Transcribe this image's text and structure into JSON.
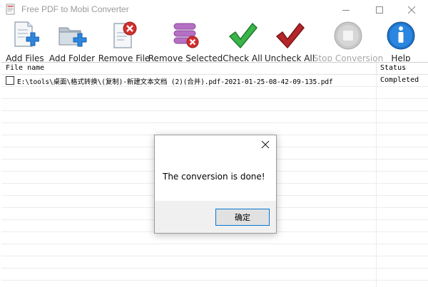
{
  "window": {
    "title": "Free PDF to Mobi Converter"
  },
  "toolbar": {
    "buttons": [
      {
        "label": "Add Files",
        "icon": "add-files-icon"
      },
      {
        "label": "Add Folder",
        "icon": "add-folder-icon"
      },
      {
        "label": "Remove File",
        "icon": "remove-file-icon"
      },
      {
        "label": "Remove Selected",
        "icon": "remove-selected-icon"
      },
      {
        "label": "Check All",
        "icon": "check-all-icon"
      },
      {
        "label": "Uncheck All",
        "icon": "uncheck-all-icon"
      },
      {
        "label": "Stop Conversion",
        "icon": "stop-conversion-icon",
        "disabled": true
      },
      {
        "label": "Help",
        "icon": "help-icon"
      }
    ]
  },
  "list": {
    "headers": {
      "name": "File name",
      "status": "Status"
    },
    "rows": [
      {
        "checked": false,
        "name": "E:\\tools\\桌面\\格式转换\\(复制)-新建文本文档 (2)(合并).pdf-2021-01-25-08-42-09-135.pdf",
        "status": "Completed"
      }
    ]
  },
  "dialog": {
    "message": "The conversion is done!",
    "ok_label": "确定"
  },
  "colors": {
    "accent": "#0078d7",
    "check_green": "#2fa82f",
    "uncheck_red": "#b4262a",
    "help_blue": "#1e72c8"
  }
}
